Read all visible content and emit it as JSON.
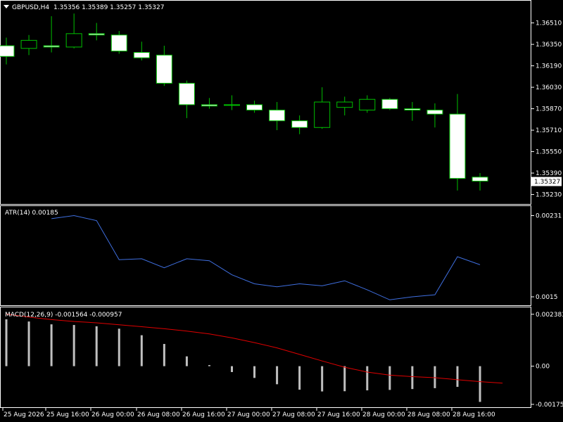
{
  "header": {
    "symbol": "GBPUSD,H4",
    "ohlc": "1.35356 1.35389 1.35257 1.35327",
    "atr": "ATR(14) 0.00185",
    "macd": "MACD(12,26,9) -0.001564 -0.000957"
  },
  "colors": {
    "background": "#000000",
    "frame": "#ffffff",
    "bull_body": "#000000",
    "bear_body": "#ffffff",
    "candle_outline": "#00c000",
    "atr_line": "#3f6fe0",
    "macd_hist": "#c0c0c0",
    "macd_signal": "#e00000"
  },
  "chart_data": [
    {
      "type": "candlestick",
      "title": "GBPUSD,H4",
      "ylim": [
        1.3517,
        1.3666
      ],
      "yticks": [
        "1.36510",
        "1.36350",
        "1.36190",
        "1.36030",
        "1.35870",
        "1.35710",
        "1.35550",
        "1.35390",
        "1.35230"
      ],
      "last_price_label": "1.35327",
      "candles": [
        {
          "o": 1.3634,
          "h": 1.364,
          "l": 1.362,
          "c": 1.3626
        },
        {
          "o": 1.3632,
          "h": 1.3642,
          "l": 1.3627,
          "c": 1.3638
        },
        {
          "o": 1.3634,
          "h": 1.3656,
          "l": 1.3629,
          "c": 1.3633
        },
        {
          "o": 1.3633,
          "h": 1.3658,
          "l": 1.3632,
          "c": 1.3643
        },
        {
          "o": 1.3643,
          "h": 1.3651,
          "l": 1.3638,
          "c": 1.3642
        },
        {
          "o": 1.3642,
          "h": 1.3645,
          "l": 1.3628,
          "c": 1.363
        },
        {
          "o": 1.3629,
          "h": 1.3637,
          "l": 1.3623,
          "c": 1.3625
        },
        {
          "o": 1.3627,
          "h": 1.3634,
          "l": 1.3604,
          "c": 1.3606
        },
        {
          "o": 1.3606,
          "h": 1.3608,
          "l": 1.358,
          "c": 1.359
        },
        {
          "o": 1.359,
          "h": 1.3595,
          "l": 1.3587,
          "c": 1.3589
        },
        {
          "o": 1.359,
          "h": 1.3597,
          "l": 1.3586,
          "c": 1.359
        },
        {
          "o": 1.359,
          "h": 1.3593,
          "l": 1.3584,
          "c": 1.3586
        },
        {
          "o": 1.3586,
          "h": 1.3592,
          "l": 1.3571,
          "c": 1.3578
        },
        {
          "o": 1.3578,
          "h": 1.3582,
          "l": 1.3568,
          "c": 1.3573
        },
        {
          "o": 1.3573,
          "h": 1.3603,
          "l": 1.3572,
          "c": 1.3592
        },
        {
          "o": 1.3588,
          "h": 1.3596,
          "l": 1.3582,
          "c": 1.3592
        },
        {
          "o": 1.3586,
          "h": 1.3597,
          "l": 1.3584,
          "c": 1.3594
        },
        {
          "o": 1.3594,
          "h": 1.3595,
          "l": 1.3586,
          "c": 1.3587
        },
        {
          "o": 1.3587,
          "h": 1.3592,
          "l": 1.3578,
          "c": 1.3586
        },
        {
          "o": 1.3586,
          "h": 1.3591,
          "l": 1.3573,
          "c": 1.3583
        },
        {
          "o": 1.3583,
          "h": 1.3598,
          "l": 1.3526,
          "c": 1.3535
        },
        {
          "o": 1.3536,
          "h": 1.3539,
          "l": 1.3526,
          "c": 1.3533
        }
      ]
    },
    {
      "type": "line",
      "title": "ATR(14) 0.00185",
      "ylim": [
        0.00143,
        0.00237
      ],
      "yticks": [
        "0.00231",
        "0.0015"
      ],
      "values": [
        0.00228,
        0.00231,
        0.00226,
        0.00187,
        0.00188,
        0.00179,
        0.00188,
        0.00186,
        0.00172,
        0.00163,
        0.0016,
        0.00163,
        0.00161,
        0.00166,
        0.00157,
        0.00147,
        0.0015,
        0.00152,
        0.0019,
        0.00182
      ]
    },
    {
      "type": "bar+line",
      "title": "MACD(12,26,9) -0.001564 -0.000957",
      "ylim": [
        -0.00182,
        0.00257
      ],
      "yticks": [
        "0.002383",
        "0.00",
        "-0.001752"
      ],
      "histogram": [
        0.00215,
        0.00205,
        0.00192,
        0.00189,
        0.00183,
        0.00172,
        0.00142,
        0.00102,
        0.00045,
        5e-05,
        -0.00027,
        -0.00054,
        -0.00083,
        -0.00108,
        -0.00116,
        -0.00115,
        -0.00111,
        -0.00109,
        -0.00105,
        -0.00101,
        -0.00095,
        -0.00164
      ],
      "signal": [
        0.00239,
        0.00225,
        0.00214,
        0.00205,
        0.00199,
        0.0019,
        0.00181,
        0.00172,
        0.00161,
        0.00148,
        0.0013,
        0.00108,
        0.00084,
        0.00054,
        0.00024,
        -5e-05,
        -0.00027,
        -0.00041,
        -0.00048,
        -0.00053,
        -0.00062,
        -0.00071,
        -0.00078
      ]
    }
  ],
  "time_axis": [
    "25 Aug 2026",
    "25 Aug 16:00",
    "26 Aug 00:00",
    "26 Aug 08:00",
    "26 Aug 16:00",
    "27 Aug 00:00",
    "27 Aug 08:00",
    "27 Aug 16:00",
    "28 Aug 00:00",
    "28 Aug 08:00",
    "28 Aug 16:00"
  ]
}
